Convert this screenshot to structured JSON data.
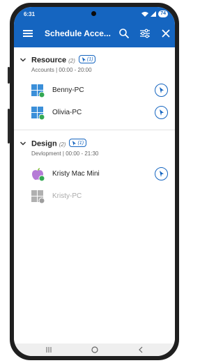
{
  "status_bar": {
    "time": "6:31",
    "battery": "74"
  },
  "header": {
    "title": "Schedule Acce..."
  },
  "groups": [
    {
      "name": "Resource",
      "count": "(2)",
      "connect_badge": "(1)",
      "subtitle": "Accounts | 00:00 - 20:00",
      "devices": [
        {
          "name": "Benny-PC",
          "os": "windows-icon",
          "status": "online"
        },
        {
          "name": "Olivia-PC",
          "os": "windows-icon",
          "status": "online"
        }
      ]
    },
    {
      "name": "Design",
      "count": "(2)",
      "connect_badge": "(1)",
      "subtitle": "Devlopment | 00:00 - 21:30",
      "devices": [
        {
          "name": "Kristy Mac Mini",
          "os": "apple-icon",
          "status": "online"
        },
        {
          "name": "Kristy-PC",
          "os": "windows-icon",
          "status": "offline"
        }
      ]
    }
  ],
  "colors": {
    "accent": "#1565c0",
    "online": "#34a853",
    "offline": "#9e9e9e",
    "windows": "#3b8fd9",
    "apple": "#b57bd6"
  }
}
